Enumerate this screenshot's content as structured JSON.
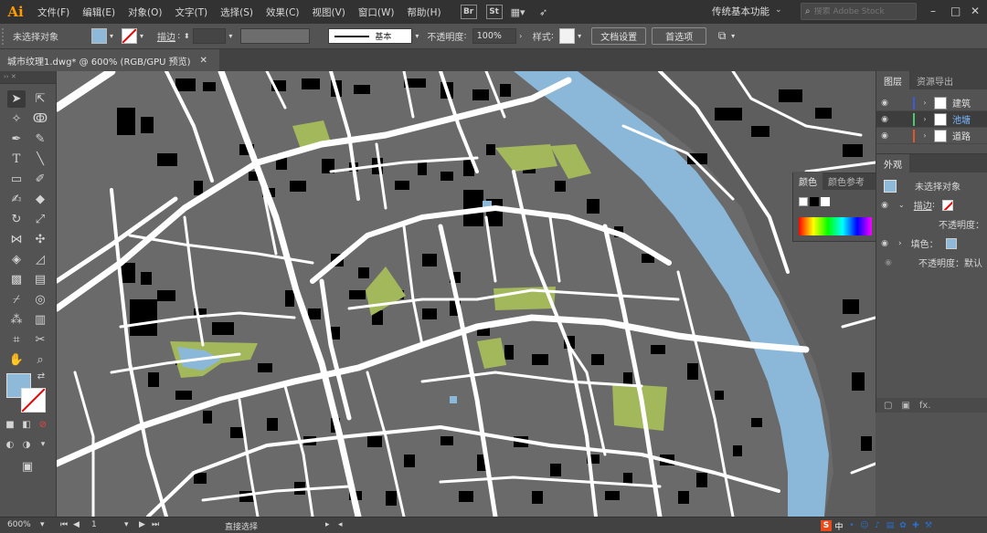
{
  "app": {
    "logo": "Ai"
  },
  "menu": [
    "文件(F)",
    "编辑(E)",
    "对象(O)",
    "文字(T)",
    "选择(S)",
    "效果(C)",
    "视图(V)",
    "窗口(W)",
    "帮助(H)"
  ],
  "bridge": {
    "br": "Br",
    "st": "St"
  },
  "workspace": {
    "label": "传统基本功能"
  },
  "stock_search": {
    "placeholder": "搜索 Adobe Stock"
  },
  "control": {
    "selection": "未选择对象",
    "stroke_label": "描边",
    "stroke_profile": "基本",
    "opacity_label": "不透明度",
    "opacity_value": "100%",
    "style_label": "样式",
    "doc_setup": "文档设置",
    "preferences": "首选项",
    "colors": {
      "fill": "#8eb9d8"
    }
  },
  "document": {
    "tab_title": "城市纹理1.dwg* @ 600% (RGB/GPU 预览)"
  },
  "layers_panel": {
    "tabs": [
      "图层",
      "资源导出"
    ],
    "layers": [
      {
        "name": "建筑",
        "color": "#3b5bd9"
      },
      {
        "name": "池塘",
        "color": "#4ec96a"
      },
      {
        "name": "道路",
        "color": "#e0572b"
      }
    ]
  },
  "color_panel": {
    "tabs": [
      "颜色",
      "颜色参考"
    ]
  },
  "appearance_panel": {
    "title": "外观",
    "object": "未选择对象",
    "stroke_label": "描边",
    "opacity_label": "不透明度",
    "fill_label": "填色",
    "opacity_default": "不透明度：默认",
    "fx": "fx."
  },
  "status": {
    "zoom": "600%",
    "page": "1",
    "tool": "直接选择"
  },
  "map_colors": {
    "block": "#6a6a6a",
    "road": "#ffffff",
    "building": "#000000",
    "green": "#a3b85b",
    "river": "#8bb8d9"
  }
}
